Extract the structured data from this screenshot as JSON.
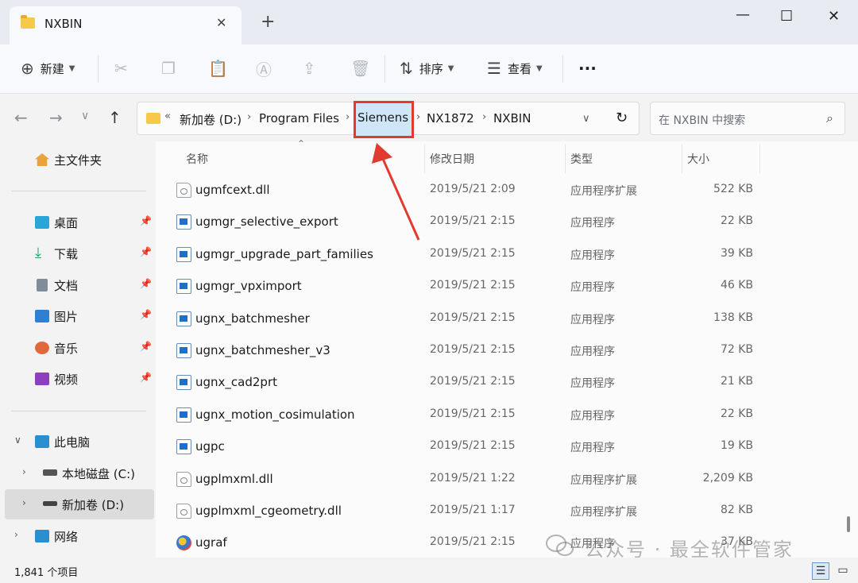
{
  "window": {
    "tab_title": "NXBIN",
    "tab_close": "✕",
    "new_tab": "+",
    "minimize": "—",
    "maximize": "☐",
    "close": "✕"
  },
  "toolbar": {
    "new_label": "新建",
    "sort_label": "排序",
    "view_label": "查看",
    "more": "···"
  },
  "breadcrumb": {
    "overflow": "«",
    "items": [
      "新加卷 (D:)",
      "Program Files",
      "Siemens",
      "NX1872",
      "NXBIN"
    ],
    "separator": "›"
  },
  "search": {
    "placeholder": "在 NXBIN 中搜索"
  },
  "sidebar": {
    "home": "主文件夹",
    "quick_access": [
      {
        "label": "桌面",
        "icon": "desktop-icon"
      },
      {
        "label": "下载",
        "icon": "download-icon"
      },
      {
        "label": "文档",
        "icon": "document-icon"
      },
      {
        "label": "图片",
        "icon": "pictures-icon"
      },
      {
        "label": "音乐",
        "icon": "music-icon"
      },
      {
        "label": "视频",
        "icon": "video-icon"
      }
    ],
    "this_pc": "此电脑",
    "drive_c": "本地磁盘 (C:)",
    "drive_d": "新加卷 (D:)",
    "network": "网络"
  },
  "columns": {
    "name": "名称",
    "date": "修改日期",
    "type": "类型",
    "size": "大小"
  },
  "files": [
    {
      "name": "ugmfcext.dll",
      "date": "2019/5/21 2:09",
      "type": "应用程序扩展",
      "size": "522 KB",
      "icon": "dll"
    },
    {
      "name": "ugmgr_selective_export",
      "date": "2019/5/21 2:15",
      "type": "应用程序",
      "size": "22 KB",
      "icon": "exe"
    },
    {
      "name": "ugmgr_upgrade_part_families",
      "date": "2019/5/21 2:15",
      "type": "应用程序",
      "size": "39 KB",
      "icon": "exe"
    },
    {
      "name": "ugmgr_vpximport",
      "date": "2019/5/21 2:15",
      "type": "应用程序",
      "size": "46 KB",
      "icon": "exe"
    },
    {
      "name": "ugnx_batchmesher",
      "date": "2019/5/21 2:15",
      "type": "应用程序",
      "size": "138 KB",
      "icon": "exe"
    },
    {
      "name": "ugnx_batchmesher_v3",
      "date": "2019/5/21 2:15",
      "type": "应用程序",
      "size": "72 KB",
      "icon": "exe"
    },
    {
      "name": "ugnx_cad2prt",
      "date": "2019/5/21 2:15",
      "type": "应用程序",
      "size": "21 KB",
      "icon": "exe"
    },
    {
      "name": "ugnx_motion_cosimulation",
      "date": "2019/5/21 2:15",
      "type": "应用程序",
      "size": "22 KB",
      "icon": "exe"
    },
    {
      "name": "ugpc",
      "date": "2019/5/21 2:15",
      "type": "应用程序",
      "size": "19 KB",
      "icon": "exe"
    },
    {
      "name": "ugplmxml.dll",
      "date": "2019/5/21 1:22",
      "type": "应用程序扩展",
      "size": "2,209 KB",
      "icon": "dll"
    },
    {
      "name": "ugplmxml_cgeometry.dll",
      "date": "2019/5/21 1:17",
      "type": "应用程序扩展",
      "size": "82 KB",
      "icon": "dll"
    },
    {
      "name": "ugraf",
      "date": "2019/5/21 2:15",
      "type": "应用程序",
      "size": "37 KB",
      "icon": "raf"
    }
  ],
  "status": {
    "item_count": "1,841 个项目"
  },
  "watermark": "公众号 · 最全软件管家",
  "colors": {
    "highlight": "#e03b2e",
    "selection": "#cfe6f8"
  }
}
